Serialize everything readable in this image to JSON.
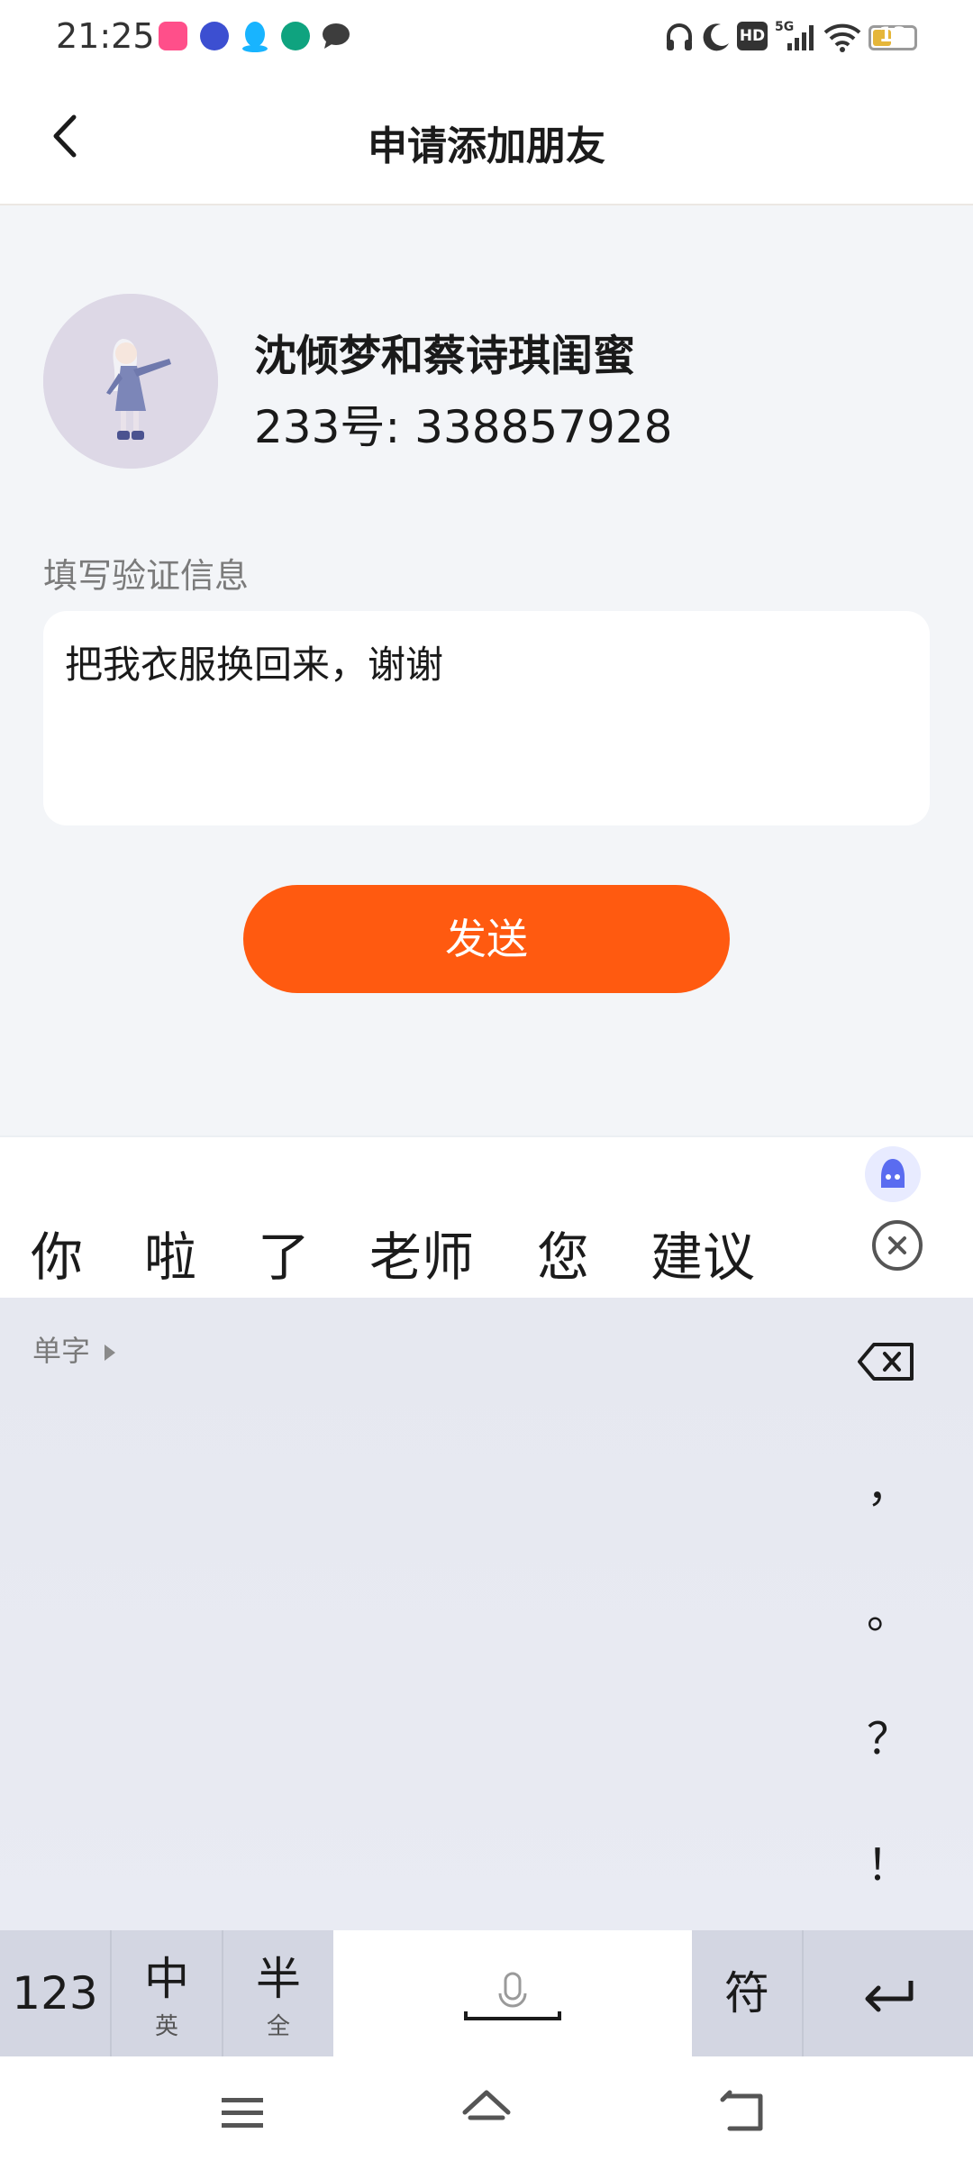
{
  "status_bar": {
    "time": "21:25",
    "battery_level": 13,
    "battery_text": "13",
    "icons": [
      "soul-app-icon",
      "tieba-app-icon",
      "qq-app-icon",
      "phone-app-icon",
      "message-app-icon",
      "headphones-icon",
      "moon-icon",
      "hd-icon",
      "5g-signal-icon",
      "wifi-icon",
      "battery-icon"
    ]
  },
  "header": {
    "title": "申请添加朋友",
    "back_icon": "chevron-left-icon"
  },
  "profile": {
    "name": "沈倾梦和蔡诗琪闺蜜",
    "id_text": "233号: 338857928"
  },
  "verification": {
    "label": "填写验证信息",
    "message": "把我衣服换回来，谢谢"
  },
  "send_button": {
    "label": "发送",
    "color": "#ff5a10"
  },
  "candidates": [
    "你",
    "啦",
    "了",
    "老师",
    "您",
    "建议"
  ],
  "keyboard": {
    "single_char_label": "单字",
    "punctuation": [
      "，",
      "。",
      "？",
      "！"
    ],
    "bottom_keys": {
      "num": "123",
      "zh_main": "中",
      "zh_sub": "英",
      "half_main": "半",
      "half_sub": "全",
      "symbol": "符"
    }
  }
}
